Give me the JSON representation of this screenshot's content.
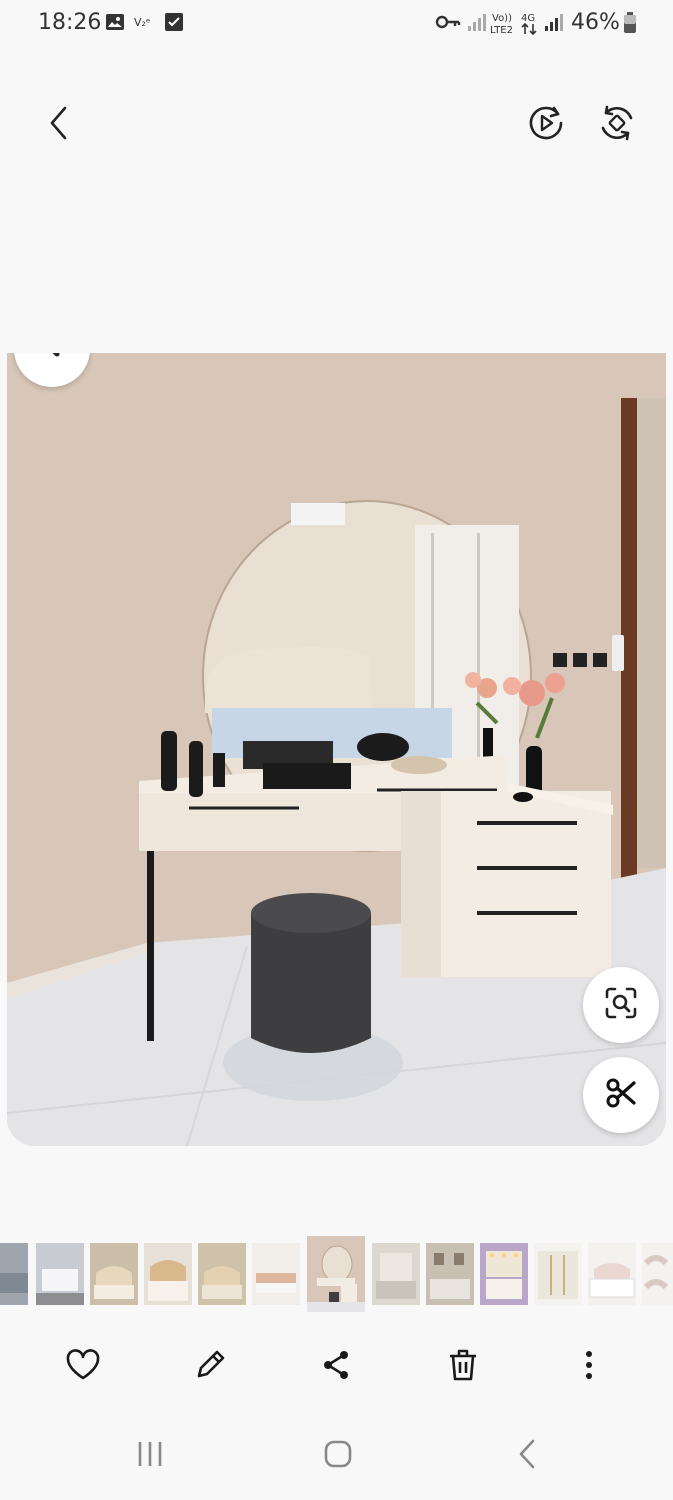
{
  "status_bar": {
    "time": "18:26",
    "battery": "46%",
    "icons": [
      "gallery-icon",
      "volte-icon",
      "checkbox-icon",
      "key-icon",
      "signal-icon",
      "volte-lte2-icon",
      "4g-icon",
      "signal-icon",
      "battery-icon"
    ],
    "network_labels": {
      "volte": "Vo)) LTE2",
      "data": "4G"
    }
  },
  "toolbar": {
    "icons": [
      "back-icon",
      "play-motion-icon",
      "rotate-icon"
    ]
  },
  "viewer": {
    "floating_icons": [
      "magnify-icon",
      "scissors-icon"
    ]
  },
  "thumbnails": {
    "count": 13,
    "active_index": 6
  },
  "actions": {
    "icons": [
      "heart-icon",
      "edit-icon",
      "share-icon",
      "delete-icon",
      "more-icon"
    ]
  },
  "navigation": {
    "icons": [
      "recent-apps-icon",
      "home-icon",
      "back-icon"
    ]
  },
  "colors": {
    "background": "#f8f8f8",
    "icon": "#1a1a1a",
    "wall": "#d8c7b8",
    "floor": "#e3e3e6"
  }
}
